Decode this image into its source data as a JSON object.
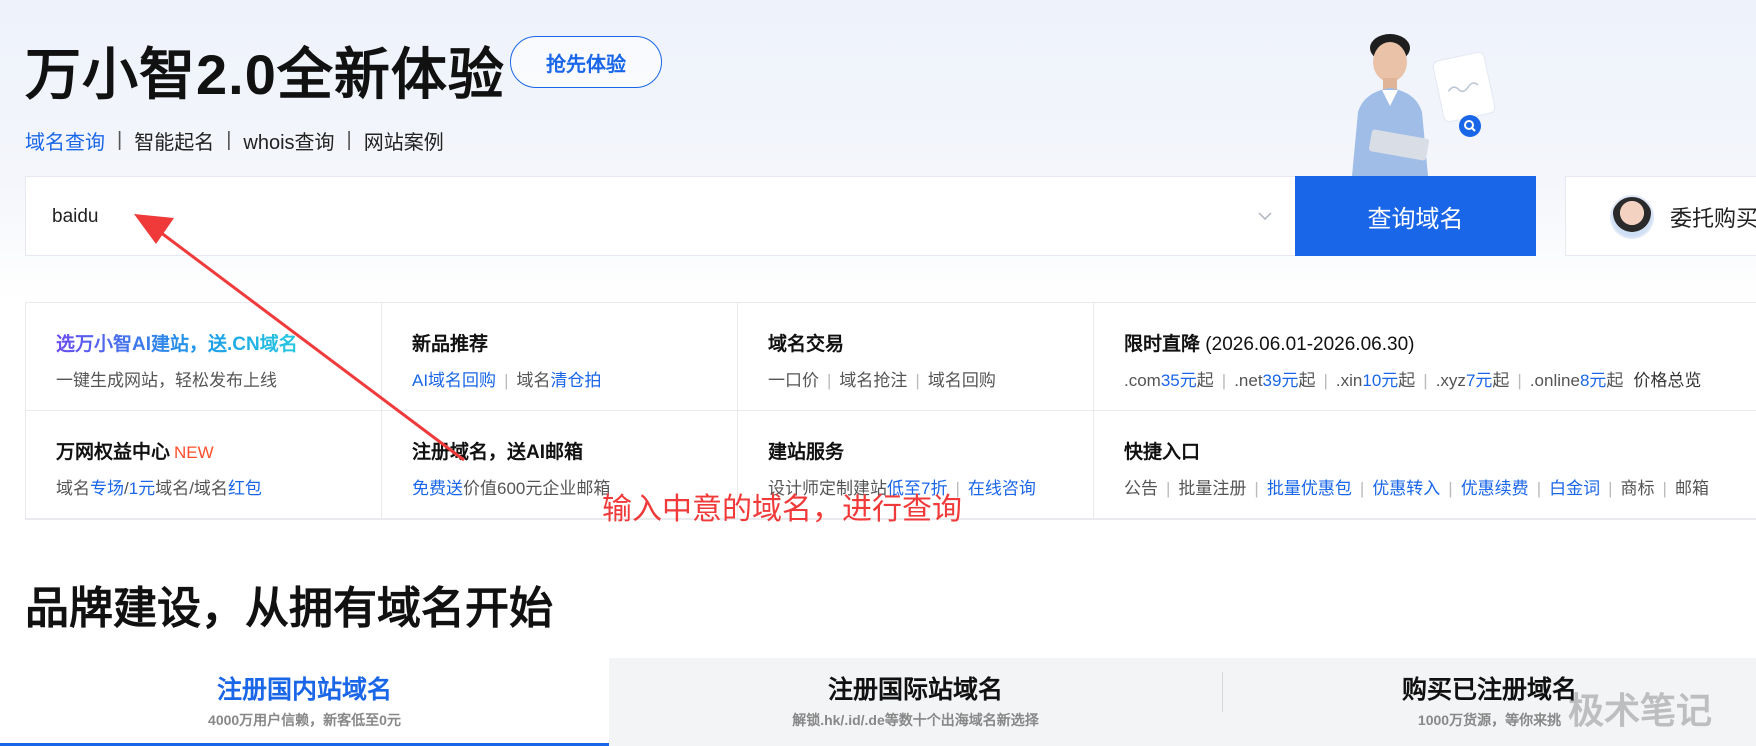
{
  "hero": {
    "title": "万小智2.0全新体验",
    "try_button": "抢先体验",
    "nav": [
      "域名查询",
      "智能起名",
      "whois查询",
      "网站案例"
    ],
    "nav_sep": "|"
  },
  "search": {
    "value": "baidu",
    "button": "查询域名",
    "broker_label": "委托购买"
  },
  "features": {
    "ai_site": {
      "title": "选万小智AI建站，送.CN域名",
      "sub": "一键生成网站，轻松发布上线"
    },
    "new_products": {
      "title": "新品推荐",
      "link1": "AI域名回购",
      "sub2_prefix": "域名",
      "link2": "清仓拍"
    },
    "domain_trade": {
      "title": "域名交易",
      "items": [
        "一口价",
        "域名抢注",
        "域名回购"
      ]
    },
    "flash_sale": {
      "title": "限时直降",
      "date_range": "(2026.06.01-2026.06.30)",
      "prices": [
        {
          "tld": ".com",
          "price": "35元",
          "suffix": "起"
        },
        {
          "tld": ".net",
          "price": "39元",
          "suffix": "起"
        },
        {
          "tld": ".xin",
          "price": "10元",
          "suffix": "起"
        },
        {
          "tld": ".xyz",
          "price": "7元",
          "suffix": "起"
        },
        {
          "tld": ".online",
          "price": "8元",
          "suffix": "起"
        }
      ],
      "overview": "价格总览"
    },
    "rights_center": {
      "title": "万网权益中心",
      "badge": "NEW",
      "s1": "域名",
      "l1": "专场",
      "s2": "/",
      "l2": "1元",
      "s3": "域名/域名",
      "l3": "红包"
    },
    "register_mail": {
      "title": "注册域名，送AI邮箱",
      "link": "免费送",
      "sub": "价值600元企业邮箱"
    },
    "site_service": {
      "title": "建站服务",
      "prefix": "设计师定制建站",
      "link1": "低至7折",
      "link2": "在线咨询"
    },
    "quick_entry": {
      "title": "快捷入口",
      "items": [
        {
          "label": "公告",
          "blue": false
        },
        {
          "label": "批量注册",
          "blue": false
        },
        {
          "label": "批量优惠包",
          "blue": true
        },
        {
          "label": "优惠转入",
          "blue": true
        },
        {
          "label": "优惠续费",
          "blue": true
        },
        {
          "label": "白金词",
          "blue": true
        },
        {
          "label": "商标",
          "blue": false
        },
        {
          "label": "邮箱",
          "blue": false
        }
      ]
    }
  },
  "annotation": "输入中意的域名，进行查询",
  "brand_title": "品牌建设，从拥有域名开始",
  "tabs": [
    {
      "title": "注册国内站域名",
      "sub": "4000万用户信赖，新客低至0元"
    },
    {
      "title": "注册国际站域名",
      "sub": "解锁.hk/.id/.de等数十个出海域名新选择"
    },
    {
      "title": "购买已注册域名",
      "sub": "1000万货源，等你来挑"
    }
  ],
  "watermark": "极术笔记",
  "colors": {
    "primary": "#1a66e8",
    "annotation": "#f03a3a",
    "new_badge": "#ff4d2d"
  }
}
